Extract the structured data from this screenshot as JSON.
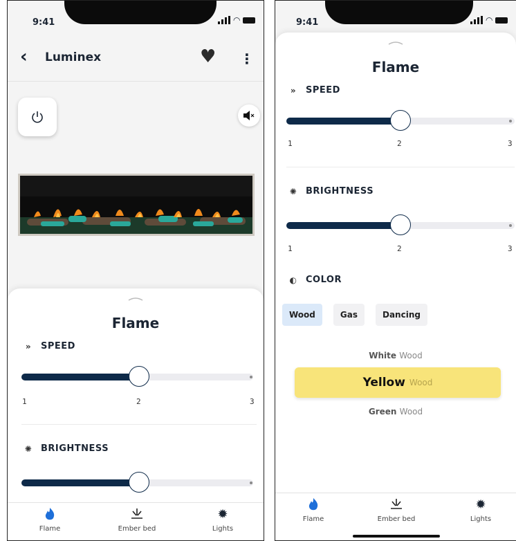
{
  "status": {
    "time": "9:41"
  },
  "header": {
    "back": "‹",
    "title": "Luminex",
    "more": "⋮"
  },
  "sheet": {
    "title": "Flame"
  },
  "speed": {
    "label": "SPEED",
    "ticks": [
      "1",
      "2",
      "3"
    ],
    "value": 2,
    "min": 1,
    "max": 3
  },
  "brightness": {
    "label": "BRIGHTNESS",
    "ticks": [
      "1",
      "2",
      "3"
    ],
    "value": 2,
    "min": 1,
    "max": 3
  },
  "color": {
    "label": "COLOR",
    "chips": [
      "Wood",
      "Gas",
      "Dancing"
    ],
    "selected_chip": "Wood",
    "options": [
      {
        "main": "White",
        "sub": "Wood"
      },
      {
        "main": "Yellow",
        "sub": "Wood",
        "selected": true
      },
      {
        "main": "Green",
        "sub": "Wood"
      }
    ]
  },
  "tabs": [
    {
      "label": "Flame",
      "icon": "flame-icon"
    },
    {
      "label": "Ember bed",
      "icon": "ember-bed-icon"
    },
    {
      "label": "Lights",
      "icon": "lights-icon"
    }
  ],
  "colors": {
    "accent": "#0e2a49",
    "flame": "#1e6fd9",
    "selected_option": "#f8e47a",
    "selected_chip": "#dbe9f9"
  }
}
